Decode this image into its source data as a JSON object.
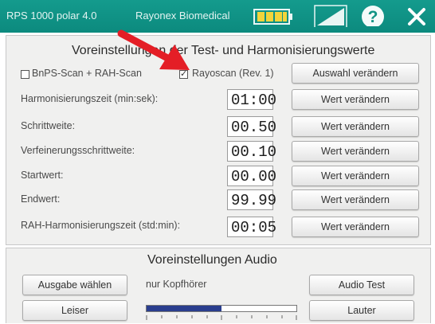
{
  "titlebar": {
    "app_name": "RPS 1000 polar 4.0",
    "company": "Rayonex Biomedical",
    "icons": [
      "battery-icon",
      "signal-icon",
      "help-icon",
      "close-icon"
    ]
  },
  "colors": {
    "titlebar": "#119484",
    "arrow": "#e41e26"
  },
  "test_settings": {
    "title": "Voreinstellungen der Test- und Harmonisierungswerte",
    "checkboxes": [
      {
        "label": "BnPS-Scan + RAH-Scan",
        "checked": false
      },
      {
        "label": "Rayoscan (Rev. 1)",
        "checked": true
      }
    ],
    "change_selection_label": "Auswahl verändern",
    "rows": [
      {
        "label": "Harmonisierungszeit (min:sek):",
        "value": "01:00",
        "button": "Wert verändern"
      },
      {
        "label": "Schrittweite:",
        "value": "00.50",
        "button": "Wert verändern"
      },
      {
        "label": "Verfeinerungsschrittweite:",
        "value": "00.10",
        "button": "Wert verändern"
      },
      {
        "label": "Startwert:",
        "value": "00.00",
        "button": "Wert verändern"
      },
      {
        "label": "Endwert:",
        "value": "99.99",
        "button": "Wert verändern"
      },
      {
        "label": "RAH-Harmonisierungszeit (std:min):",
        "value": "00:05",
        "button": "Wert verändern"
      }
    ]
  },
  "audio_settings": {
    "title": "Voreinstellungen Audio",
    "select_output_label": "Ausgabe wählen",
    "output_value": "nur Kopfhörer",
    "audio_test_label": "Audio Test",
    "quieter_label": "Leiser",
    "louder_label": "Lauter",
    "volume_level": 0.5
  }
}
